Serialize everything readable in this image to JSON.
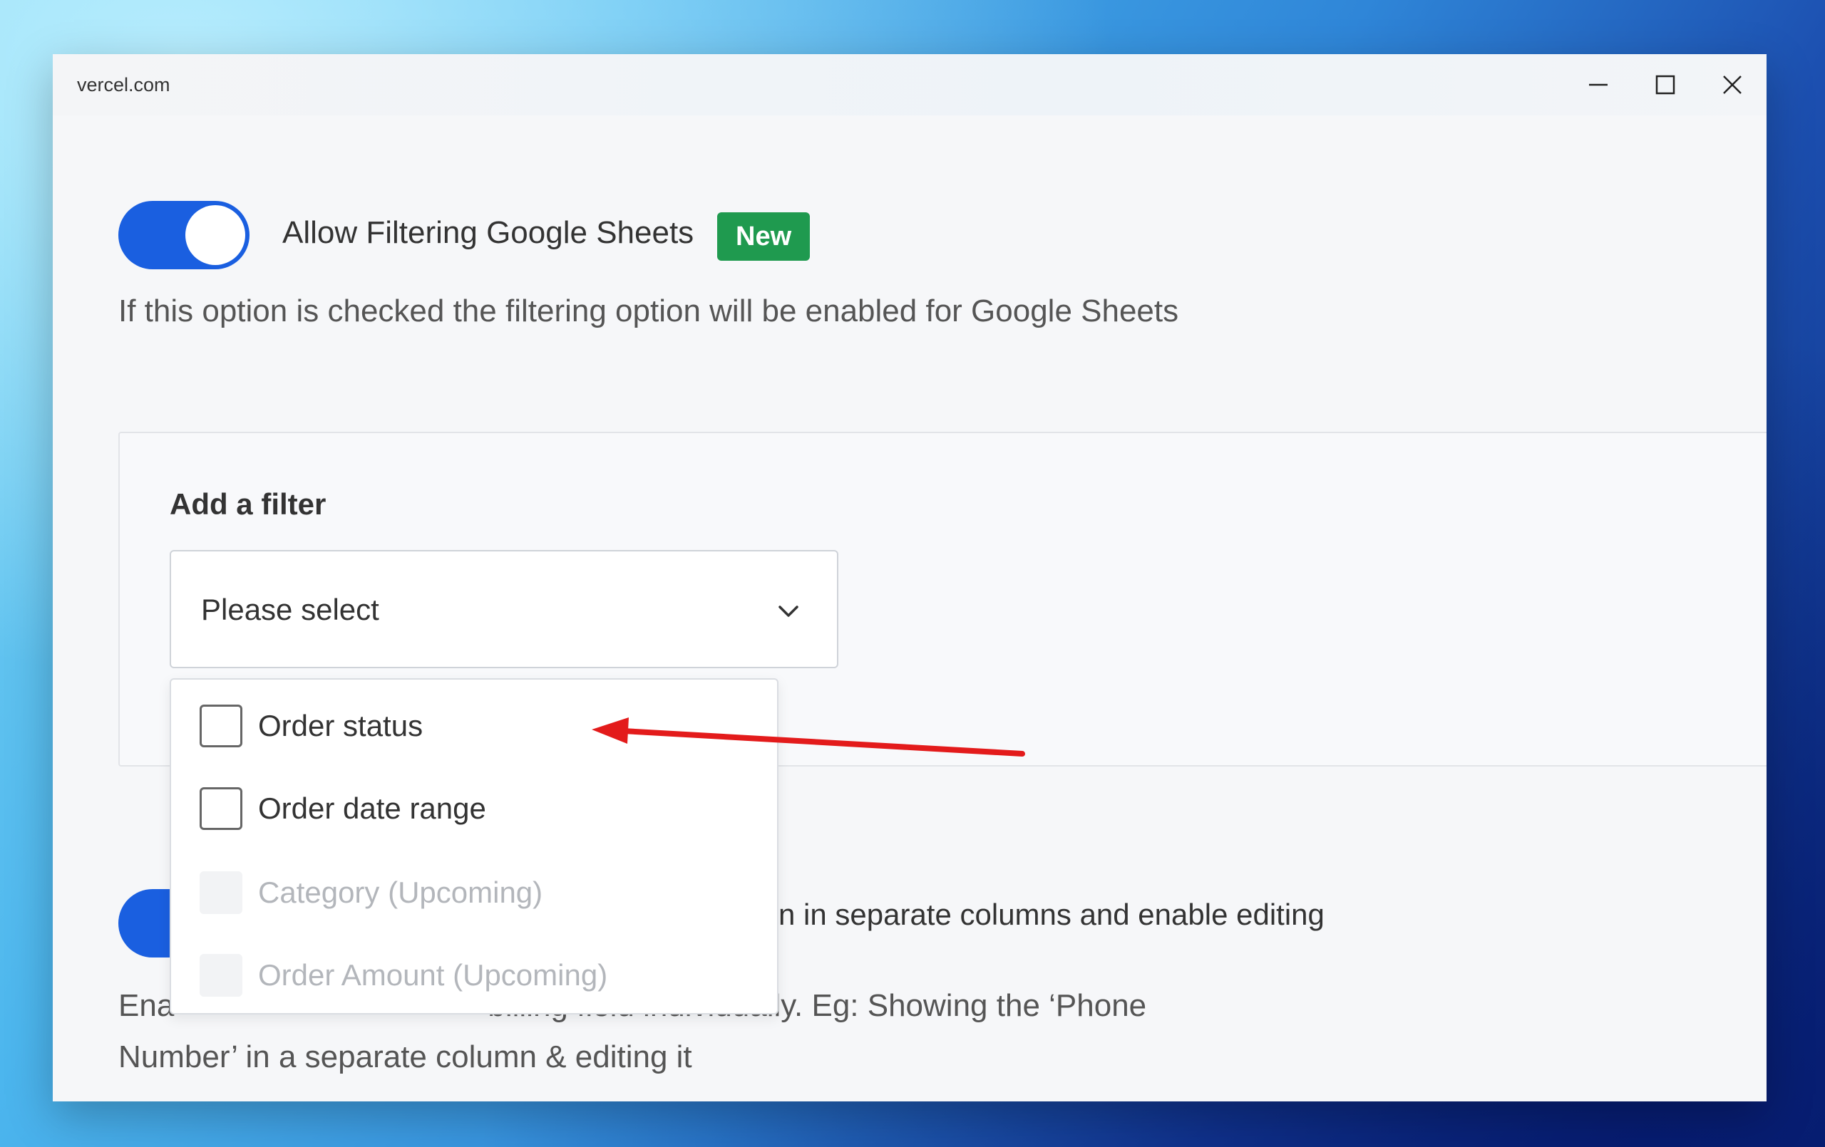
{
  "window": {
    "title": "vercel.com",
    "controls": [
      "minimize-icon",
      "maximize-icon",
      "close-icon"
    ]
  },
  "filtering_option": {
    "label": "Allow Filtering Google Sheets",
    "badge": "New",
    "enabled": true,
    "description": "If this option is checked the filtering option will be enabled for Google Sheets"
  },
  "filter_card": {
    "title": "Add a filter",
    "select_value": "Please select",
    "options": [
      {
        "label": "Order status",
        "disabled": false
      },
      {
        "label": "Order date range",
        "disabled": false
      },
      {
        "label": "Category (Upcoming)",
        "disabled": true
      },
      {
        "label": "Order Amount (Upcoming)",
        "disabled": true
      }
    ]
  },
  "second_option": {
    "label_visible": "n in separate columns and enable editing",
    "enabled": true,
    "description_line1": "Ena                                    billing field individually. Eg: Showing the ‘Phone",
    "description_line2": "Number’ in a separate column & editing it"
  },
  "annotation": {
    "arrow_color": "#e31b1b"
  },
  "colors": {
    "toggle_blue": "#1a5fe0",
    "badge_green": "#1f9a4f"
  }
}
